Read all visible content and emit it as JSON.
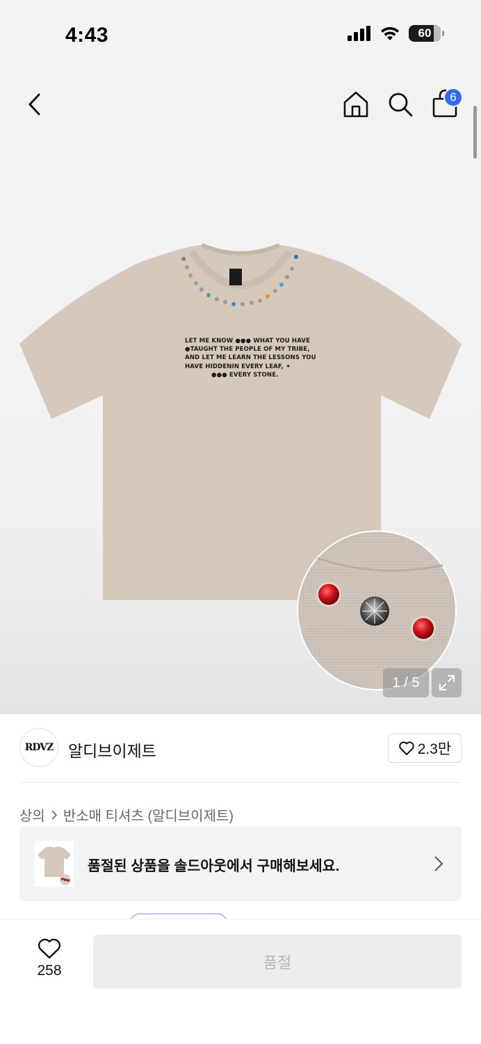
{
  "status_bar": {
    "time": "4:43",
    "battery": "60"
  },
  "header": {
    "cart_count": "6"
  },
  "product_image": {
    "print_lines": [
      "LET ME KNOW ●●● WHAT YOU HAVE",
      "●TAUGHT THE PEOPLE OF MY TRIBE,",
      "AND LET ME LEARN THE LESSONS YOU",
      "HAVE HIDDENIN EVERY LEAF, ✦",
      "●●● EVERY STONE."
    ],
    "pager": "1 / 5",
    "colors": {
      "tee": "#d6c8bb",
      "stone_red": "#d4141b"
    }
  },
  "brand": {
    "logo_text": "RDVZ",
    "name": "알디브이제트",
    "like_count": "2.3만"
  },
  "breadcrumb": {
    "category": "상의",
    "subcategory": "반소매 티셔츠 (알디브이제트)"
  },
  "soldout_banner": {
    "text": "품절된 상품을 솔드아웃에서 구매해보세요."
  },
  "bottom_bar": {
    "wish_count": "258",
    "buy_label": "품절"
  }
}
